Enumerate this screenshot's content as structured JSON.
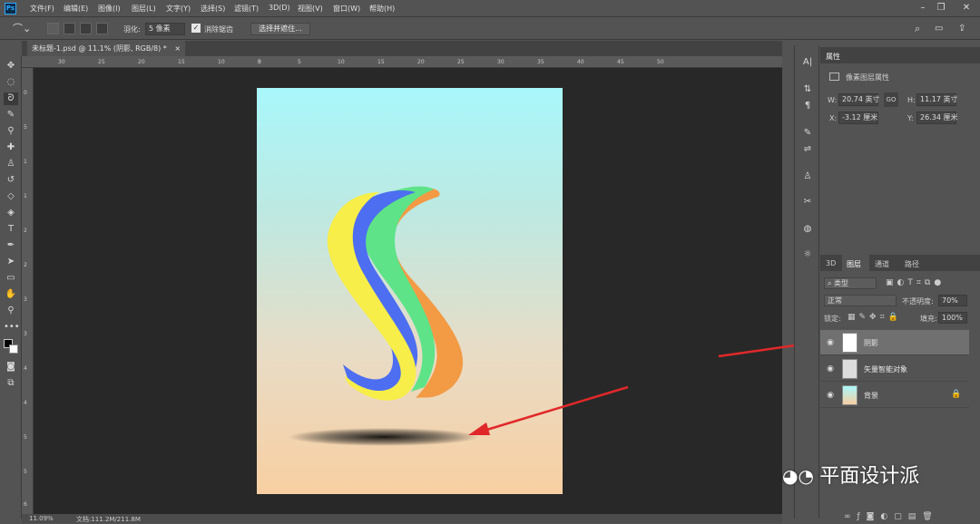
{
  "menu": {
    "logo": "Ps",
    "items": [
      "文件(F)",
      "编辑(E)",
      "图像(I)",
      "图层(L)",
      "文字(Y)",
      "选择(S)",
      "滤镜(T)",
      "3D(D)",
      "视图(V)",
      "窗口(W)",
      "帮助(H)"
    ]
  },
  "options_bar": {
    "feather_label": "羽化:",
    "feather_value": "5 像素",
    "antialias_label": "消除锯齿",
    "select_mask_button": "选择并遮住..."
  },
  "document_tab": {
    "label": "未标题-1.psd @ 11.1% (阴影, RGB/8) *",
    "close": "×"
  },
  "rulers": {
    "top": [
      "30",
      "25",
      "20",
      "15",
      "10",
      "5",
      "0",
      "5",
      "10",
      "15",
      "20",
      "25",
      "30",
      "35",
      "40",
      "45",
      "50"
    ],
    "left": [
      "0",
      "5",
      "1",
      "1",
      "2",
      "2",
      "3",
      "3",
      "4",
      "4",
      "5",
      "5",
      "6"
    ]
  },
  "artwork": {
    "letter": "S"
  },
  "status_bar": {
    "zoom": "11.09%",
    "doc_info": "文档:111.2M/211.8M"
  },
  "properties_panel": {
    "tab": "属性",
    "subtitle": "像素图层属性",
    "w_label": "W:",
    "w_value": "20.74 英寸",
    "h_label": "H:",
    "h_value": "11.17 英寸",
    "x_label": "X:",
    "x_value": "-3.12 厘米",
    "y_label": "Y:",
    "y_value": "26.34 厘米",
    "link_icon": "GO"
  },
  "layers_panel": {
    "tabs": [
      "3D",
      "图层",
      "通道",
      "路径"
    ],
    "filter_kind": "类型",
    "blend_mode": "正常",
    "opacity_label": "不透明度:",
    "opacity_value": "70%",
    "lock_label": "锁定:",
    "fill_label": "填充:",
    "fill_value": "100%",
    "layers": [
      {
        "name": "阴影",
        "selected": true
      },
      {
        "name": "矢量智能对象",
        "selected": false
      },
      {
        "name": "背景",
        "selected": false
      }
    ]
  },
  "watermark": {
    "text": "平面设计派"
  },
  "colors": {
    "accent_arrow": "#e0282a",
    "panel_bg": "#535353",
    "workspace_bg": "#282828"
  }
}
